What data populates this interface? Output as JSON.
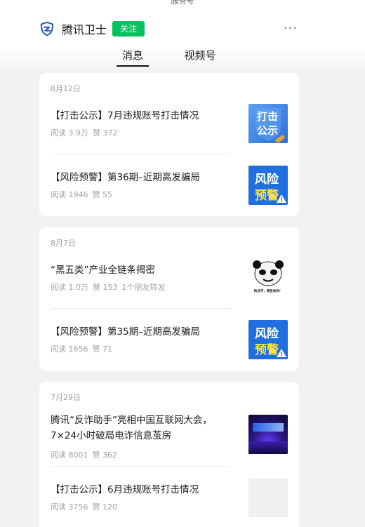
{
  "status_stub": "服务号",
  "header": {
    "account_name": "腾讯卫士",
    "follow_label": "关注",
    "more_label": "···",
    "logo_icon": "shield-icon",
    "brand_color": "#2a55c7",
    "follow_color": "#07c160"
  },
  "tabs": [
    {
      "label": "消息",
      "active": true
    },
    {
      "label": "视频号",
      "active": false
    }
  ],
  "groups": [
    {
      "date": "8月12日",
      "articles": [
        {
          "title": "【打击公示】7月违规账号打击情况",
          "read": "阅读 3.9万",
          "likes": "赞 372",
          "extra": "",
          "thumb": "strike-notice-icon",
          "thumb_text": [
            "打击",
            "公示"
          ]
        },
        {
          "title": "【风险预警】第36期–近期高发骗局",
          "read": "阅读 1946",
          "likes": "赞 55",
          "extra": "",
          "thumb": "risk-warning-icon",
          "thumb_text": [
            "风险",
            "预警"
          ]
        }
      ]
    },
    {
      "date": "8月7日",
      "articles": [
        {
          "title": "“黑五类”产业全链条揭密",
          "read": "阅读 1.0万",
          "likes": "赞 153",
          "extra": "1个朋友转发",
          "thumb": "panda-meme-image",
          "thumb_text": [
            "快点开，我告诉你！"
          ]
        },
        {
          "title": "【风险预警】第35期–近期高发骗局",
          "read": "阅读 1656",
          "likes": "赞 71",
          "extra": "",
          "thumb": "risk-warning-icon",
          "thumb_text": [
            "风险",
            "预警"
          ]
        }
      ]
    },
    {
      "date": "7月29日",
      "articles": [
        {
          "title": "腾讯“反诈助手”亮相中国互联网大会，7×24小时破局电诈信息茧房",
          "read": "阅读 8001",
          "likes": "赞 362",
          "extra": "",
          "thumb": "conference-stage-image",
          "thumb_text": []
        },
        {
          "title": "【打击公示】6月违规账号打击情况",
          "read": "阅读 3756",
          "likes": "赞 120",
          "extra": "",
          "thumb": "placeholder-image",
          "thumb_text": []
        }
      ]
    }
  ]
}
